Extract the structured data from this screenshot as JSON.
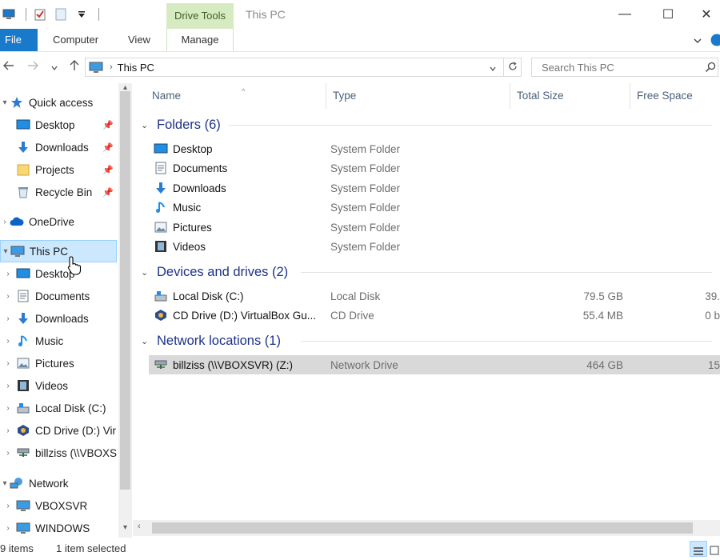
{
  "window": {
    "title": "This PC",
    "context_tab_header": "Drive Tools",
    "minimize": "—",
    "maximize": "☐",
    "close": "✕"
  },
  "ribbon": {
    "tabs": [
      {
        "label": "File"
      },
      {
        "label": "Computer"
      },
      {
        "label": "View"
      },
      {
        "label": "Manage"
      }
    ],
    "expand_icon": "chevron-down-icon",
    "help_icon": "help-icon"
  },
  "address_bar": {
    "crumb": "This PC",
    "search_placeholder": "Search This PC"
  },
  "nav_pane": {
    "items": [
      {
        "label": "Quick access",
        "icon": "star-icon",
        "expanded": true
      },
      {
        "label": "Desktop",
        "icon": "desktop-icon",
        "pinned": true
      },
      {
        "label": "Downloads",
        "icon": "download-icon",
        "pinned": true
      },
      {
        "label": "Projects",
        "icon": "folder-icon",
        "pinned": true
      },
      {
        "label": "Recycle Bin",
        "icon": "recycle-bin-icon",
        "pinned": true
      },
      {
        "label": "OneDrive",
        "icon": "cloud-icon"
      },
      {
        "label": "This PC",
        "icon": "computer-icon",
        "expanded": true,
        "selected": true
      },
      {
        "label": "Desktop",
        "icon": "desktop-icon"
      },
      {
        "label": "Documents",
        "icon": "documents-icon"
      },
      {
        "label": "Downloads",
        "icon": "download-icon"
      },
      {
        "label": "Music",
        "icon": "music-icon"
      },
      {
        "label": "Pictures",
        "icon": "pictures-icon"
      },
      {
        "label": "Videos",
        "icon": "videos-icon"
      },
      {
        "label": "Local Disk (C:)",
        "icon": "disk-icon"
      },
      {
        "label": "CD Drive (D:) Vir",
        "icon": "cd-drive-icon"
      },
      {
        "label": "billziss (\\\\VBOXS",
        "icon": "network-drive-icon"
      },
      {
        "label": "Network",
        "icon": "network-icon",
        "expanded": true
      },
      {
        "label": "VBOXSVR",
        "icon": "computer-icon"
      },
      {
        "label": "WINDOWS",
        "icon": "computer-icon"
      }
    ]
  },
  "columns": {
    "name": "Name",
    "type": "Type",
    "total_size": "Total Size",
    "free_space": "Free Space"
  },
  "groups": {
    "folders": {
      "title": "Folders (6)",
      "items": [
        {
          "name": "Desktop",
          "type": "System Folder",
          "icon": "desktop-icon"
        },
        {
          "name": "Documents",
          "type": "System Folder",
          "icon": "documents-icon"
        },
        {
          "name": "Downloads",
          "type": "System Folder",
          "icon": "download-icon"
        },
        {
          "name": "Music",
          "type": "System Folder",
          "icon": "music-icon"
        },
        {
          "name": "Pictures",
          "type": "System Folder",
          "icon": "pictures-icon"
        },
        {
          "name": "Videos",
          "type": "System Folder",
          "icon": "videos-icon"
        }
      ]
    },
    "devices": {
      "title": "Devices and drives (2)",
      "items": [
        {
          "name": "Local Disk (C:)",
          "type": "Local Disk",
          "total": "79.5 GB",
          "free": "39.",
          "icon": "disk-icon"
        },
        {
          "name": "CD Drive (D:) VirtualBox Gu...",
          "type": "CD Drive",
          "total": "55.4 MB",
          "free": "0 b",
          "icon": "cd-drive-icon"
        }
      ]
    },
    "network": {
      "title": "Network locations (1)",
      "items": [
        {
          "name": "billziss (\\\\VBOXSVR) (Z:)",
          "type": "Network Drive",
          "total": "464 GB",
          "free": "15",
          "icon": "network-drive-icon",
          "selected": true
        }
      ]
    }
  },
  "status": {
    "items_count": "9 items",
    "selected": "1 item selected"
  },
  "colors": {
    "accent": "#1979ca",
    "selection": "#cce8ff",
    "context_tab": "#d7ebc3",
    "group_title": "#1e3287"
  }
}
